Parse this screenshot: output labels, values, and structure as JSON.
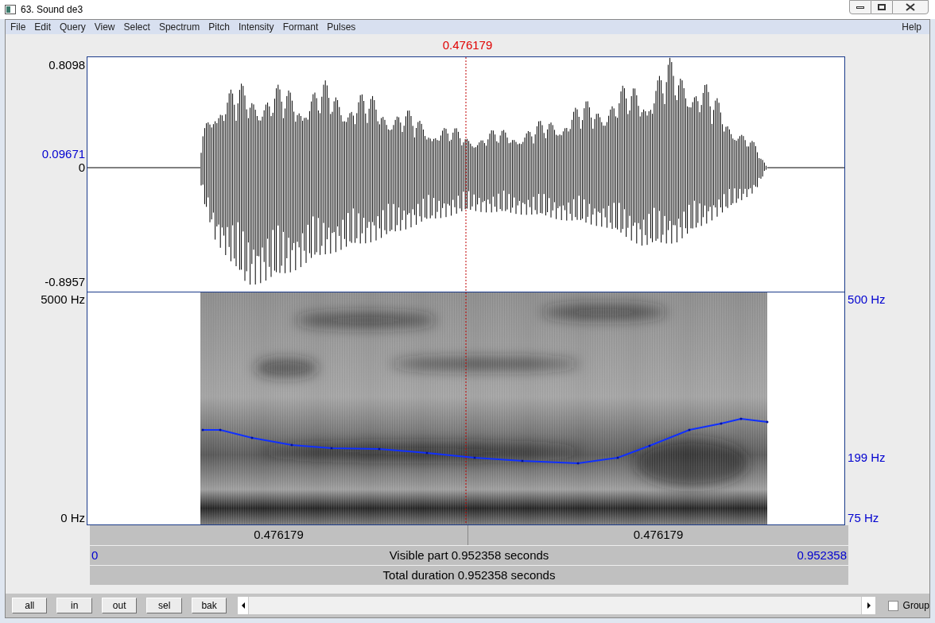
{
  "window": {
    "title": "63. Sound de3"
  },
  "menu": [
    "File",
    "Edit",
    "Query",
    "View",
    "Select",
    "Spectrum",
    "Pitch",
    "Intensity",
    "Formant",
    "Pulses"
  ],
  "help_menu": "Help",
  "cursor_time": "0.476179",
  "waveform": {
    "y_max": "0.8098",
    "y_mark": "0.09671",
    "y_zero": "0",
    "y_min": "-0.8957"
  },
  "spectrogram": {
    "y_max": "5000 Hz",
    "y_min": "0 Hz"
  },
  "pitch": {
    "y_max": "500 Hz",
    "y_mark": "199 Hz",
    "y_min": "75 Hz"
  },
  "time_bars": {
    "left_part": "0.476179",
    "right_part": "0.476179",
    "start": "0",
    "visible_part": "Visible part 0.952358 seconds",
    "end": "0.952358",
    "total_duration": "Total duration 0.952358 seconds"
  },
  "buttons": [
    "all",
    "in",
    "out",
    "sel",
    "bak"
  ],
  "group": {
    "label": "Group",
    "checked": false
  }
}
